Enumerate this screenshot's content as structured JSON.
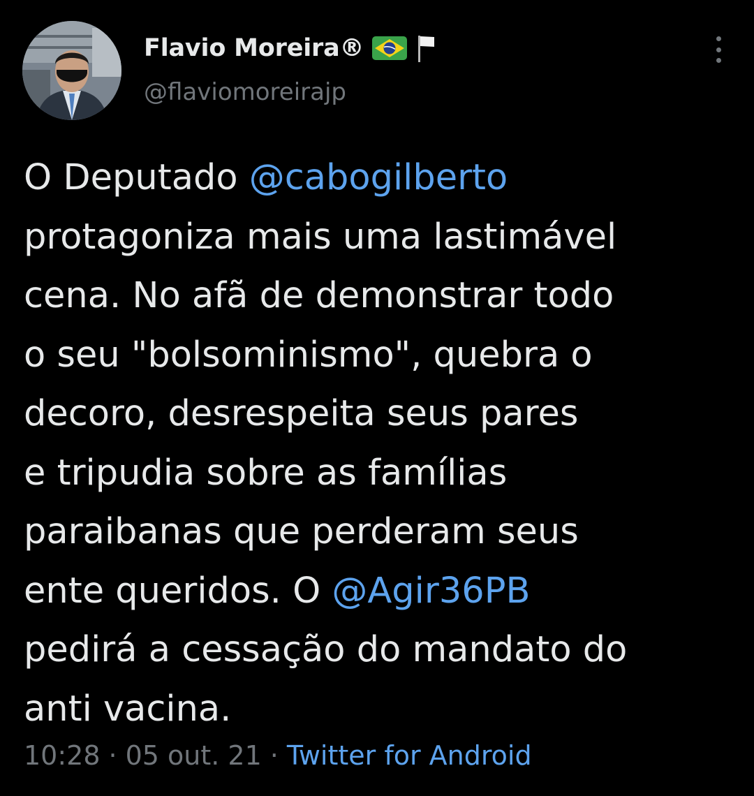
{
  "author": {
    "display_name": "Flavio Moreira®",
    "handle": "@flaviomoreirajp",
    "badges": [
      "brazil-flag-icon",
      "white-flag-icon"
    ]
  },
  "tweet": {
    "lines": [
      [
        {
          "t": "O Deputado ",
          "m": false
        },
        {
          "t": "@cabogilberto",
          "m": true
        }
      ],
      [
        {
          "t": "protagoniza mais uma lastimável",
          "m": false
        }
      ],
      [
        {
          "t": "cena. No afã de demonstrar todo",
          "m": false
        }
      ],
      [
        {
          "t": "o seu \"bolsominismo\", quebra o",
          "m": false
        }
      ],
      [
        {
          "t": "decoro, desrespeita seus pares",
          "m": false
        }
      ],
      [
        {
          "t": "e tripudia sobre as famílias",
          "m": false
        }
      ],
      [
        {
          "t": "paraibanas que perderam seus",
          "m": false
        }
      ],
      [
        {
          "t": "ente queridos. O ",
          "m": false
        },
        {
          "t": "@Agir36PB",
          "m": true
        }
      ],
      [
        {
          "t": "pedirá a cessação do mandato do",
          "m": false
        }
      ],
      [
        {
          "t": "anti vacina.",
          "m": false
        }
      ]
    ]
  },
  "meta": {
    "time": "10:28",
    "separator": "·",
    "date": "05 out. 21",
    "source": "Twitter for Android"
  },
  "colors": {
    "background": "#000000",
    "text": "#e7e9ea",
    "secondary": "#71767b",
    "link": "#5da3ee"
  },
  "icons": {
    "more": "more-vertical-icon"
  }
}
